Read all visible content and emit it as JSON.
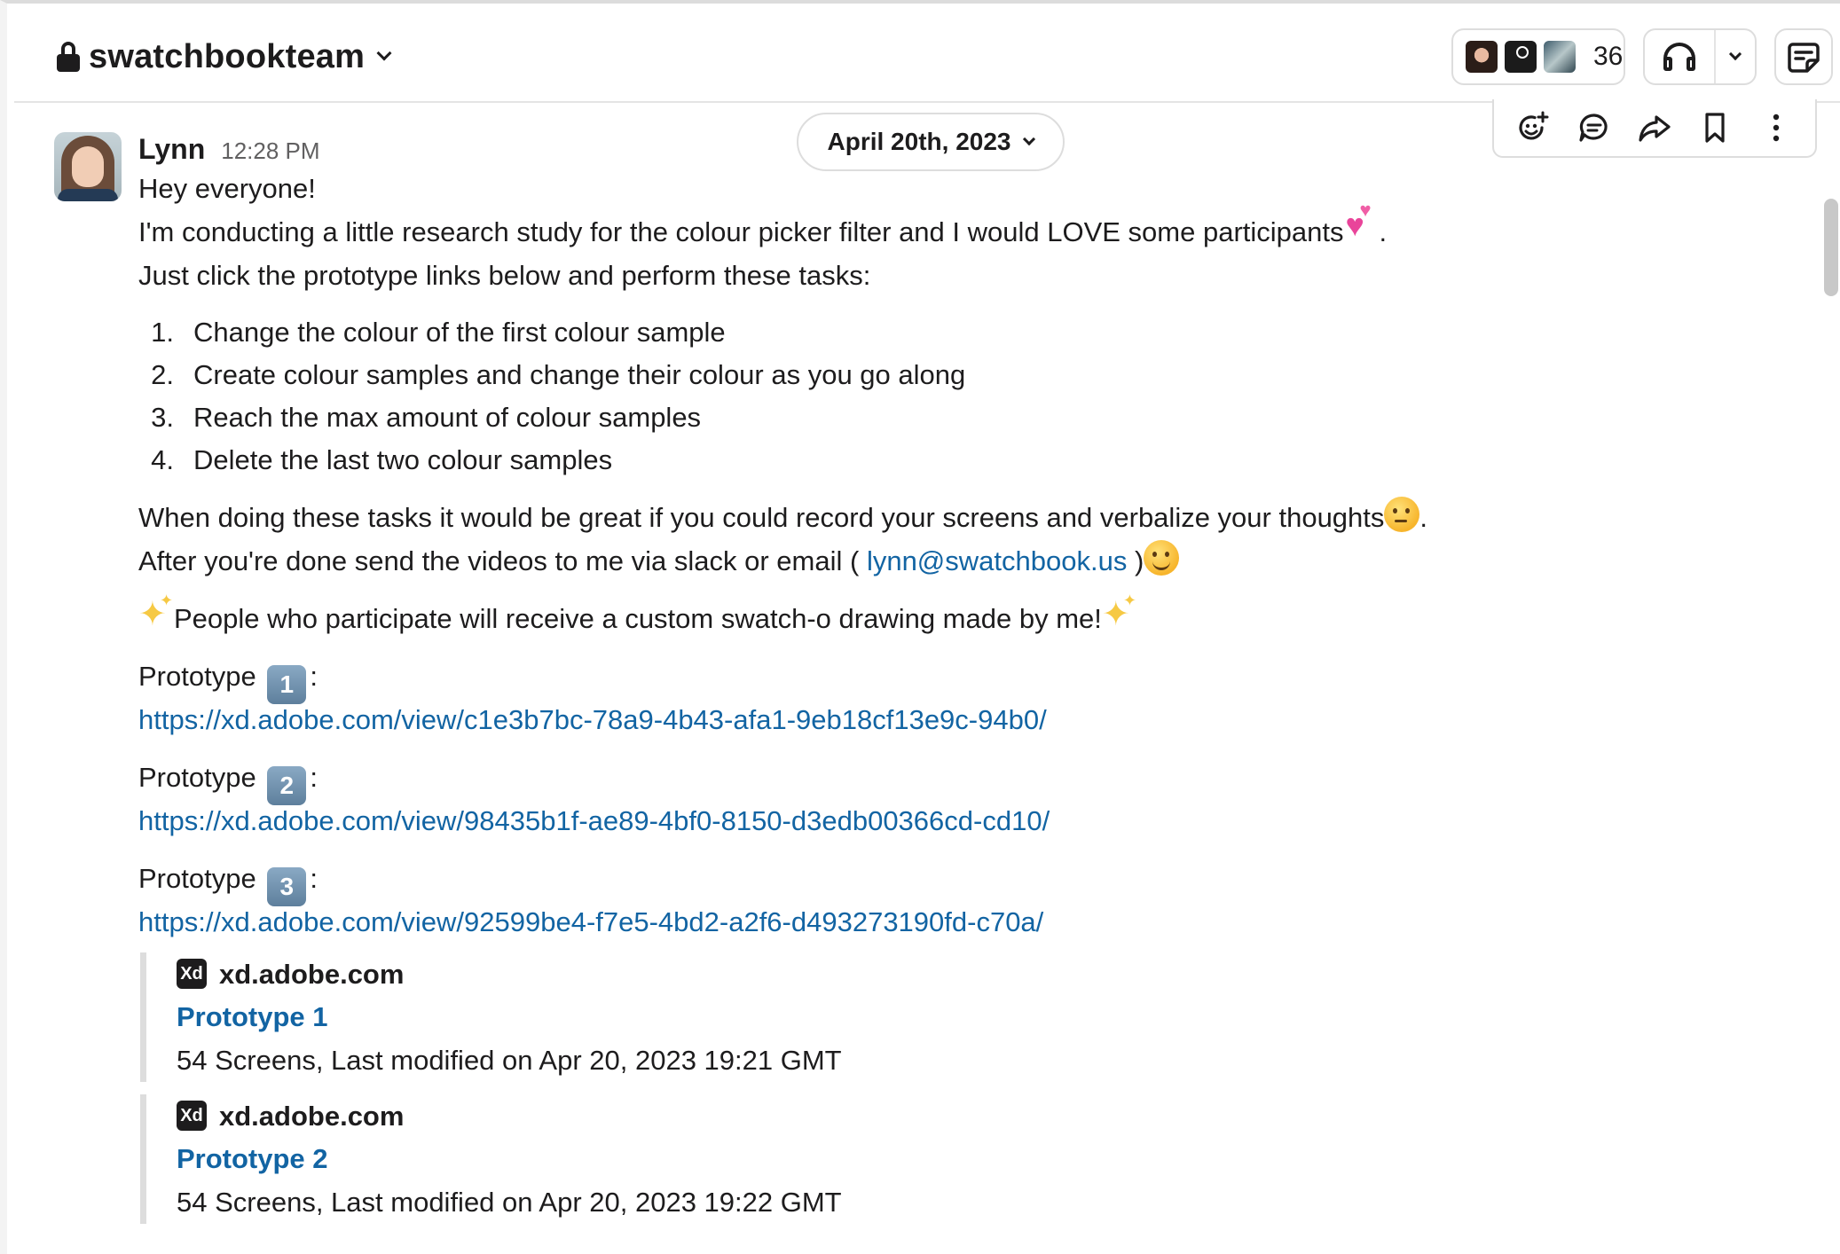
{
  "header": {
    "channel_name": "swatchbookteam",
    "member_count": "36"
  },
  "date_divider": {
    "label": "April 20th, 2023"
  },
  "message": {
    "author": "Lynn",
    "time": "12:28 PM",
    "line1": "Hey everyone!",
    "line2": "I'm conducting a little research study for the colour picker filter and I would LOVE some participants",
    "line2_end": ".",
    "line3": "Just click the prototype links below and perform these tasks:",
    "tasks": [
      {
        "num": "1.",
        "text": "Change the colour of the first colour sample"
      },
      {
        "num": "2.",
        "text": "Create colour samples and change their colour as you go along"
      },
      {
        "num": "3.",
        "text": "Reach the max amount of colour samples"
      },
      {
        "num": "4.",
        "text": "Delete the last two colour samples"
      }
    ],
    "line4": "When doing these tasks it would be great if you could record your screens and verbalize your thoughts",
    "line4_end": ".",
    "line5_pre": "After you're done send the videos to me via slack or email ( ",
    "email": "lynn@swatchbook.us",
    "line5_post": " )",
    "line6": "People who participate will receive a custom swatch-o drawing made by me!",
    "prototypes": [
      {
        "label": "Prototype ",
        "key": "1",
        "colon": ":",
        "url": "https://xd.adobe.com/view/c1e3b7bc-78a9-4b43-afa1-9eb18cf13e9c-94b0/"
      },
      {
        "label": "Prototype ",
        "key": "2",
        "colon": ":",
        "url": "https://xd.adobe.com/view/98435b1f-ae89-4bf0-8150-d3edb00366cd-cd10/"
      },
      {
        "label": "Prototype ",
        "key": "3",
        "colon": ":",
        "url": "https://xd.adobe.com/view/92599be4-f7e5-4bd2-a2f6-d493273190fd-c70a/"
      }
    ],
    "unfurls": [
      {
        "icon": "Xd",
        "site": "xd.adobe.com",
        "title": "Prototype 1",
        "desc": "54 Screens, Last modified on Apr 20, 2023 19:21 GMT"
      },
      {
        "icon": "Xd",
        "site": "xd.adobe.com",
        "title": "Prototype 2",
        "desc": "54 Screens, Last modified on Apr 20, 2023 19:22 GMT"
      }
    ]
  },
  "icons": {
    "lock": "lock-icon",
    "headphones": "headphones-icon",
    "canvas": "canvas-icon",
    "add_reaction": "add-reaction-icon",
    "reply_thread": "reply-in-thread-icon",
    "forward": "forward-icon",
    "bookmark": "bookmark-icon",
    "more": "more-actions-icon"
  },
  "colors": {
    "link": "#1264a3",
    "text": "#1d1c1d",
    "muted": "#616061"
  }
}
